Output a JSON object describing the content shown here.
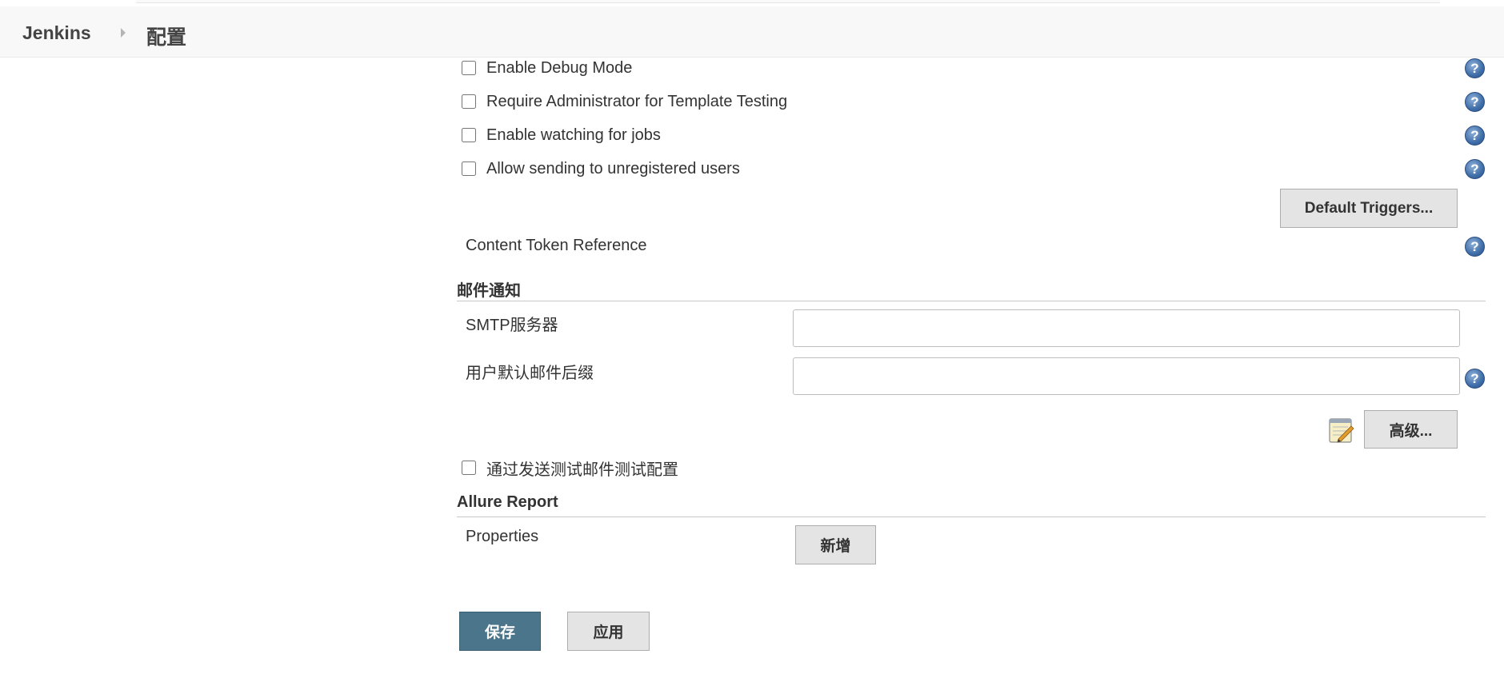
{
  "breadcrumb": {
    "home": "Jenkins",
    "current": "配置"
  },
  "options": [
    {
      "label": "Enable Debug Mode",
      "checked": false
    },
    {
      "label": "Require Administrator for Template Testing",
      "checked": false
    },
    {
      "label": "Enable watching for jobs",
      "checked": false
    },
    {
      "label": "Allow sending to unregistered users",
      "checked": false
    }
  ],
  "buttons": {
    "default_triggers": "Default Triggers...",
    "advanced": "高级...",
    "add": "新增",
    "save": "保存",
    "apply": "应用"
  },
  "content_token_reference": "Content Token Reference",
  "mail": {
    "section_title": "邮件通知",
    "smtp_label": "SMTP服务器",
    "smtp_value": "",
    "suffix_label": "用户默认邮件后缀",
    "suffix_value": "",
    "test_label": "通过发送测试邮件测试配置"
  },
  "allure": {
    "section_title": "Allure Report",
    "properties_label": "Properties"
  },
  "help_icon": "?",
  "colors": {
    "primary": "#4b758b",
    "help": "#3f6ea8"
  }
}
